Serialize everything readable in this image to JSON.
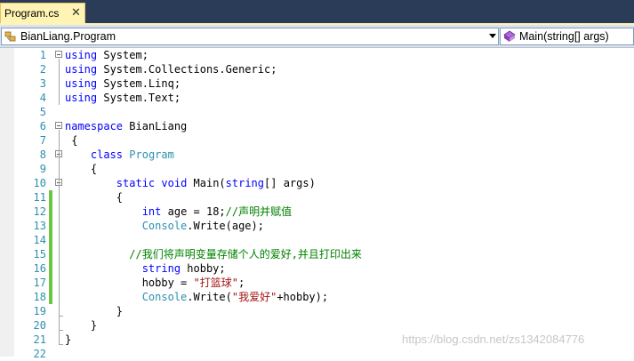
{
  "tab": {
    "title": "Program.cs",
    "close_glyph": "✕"
  },
  "navbar": {
    "type_combo": "BianLiang.Program",
    "member_combo": "Main(string[] args)"
  },
  "editor": {
    "lines": [
      {
        "n": "1",
        "tokens": [
          [
            "kw",
            "using"
          ],
          [
            "",
            " System;"
          ]
        ]
      },
      {
        "n": "2",
        "tokens": [
          [
            "kw",
            "using"
          ],
          [
            "",
            " System.Collections.Generic;"
          ]
        ]
      },
      {
        "n": "3",
        "tokens": [
          [
            "kw",
            "using"
          ],
          [
            "",
            " System.Linq;"
          ]
        ]
      },
      {
        "n": "4",
        "tokens": [
          [
            "kw",
            "using"
          ],
          [
            "",
            " System.Text;"
          ]
        ]
      },
      {
        "n": "5",
        "tokens": []
      },
      {
        "n": "6",
        "tokens": [
          [
            "kw",
            "namespace"
          ],
          [
            "",
            " BianLiang"
          ]
        ]
      },
      {
        "n": "7",
        "tokens": [
          [
            "",
            " {"
          ]
        ]
      },
      {
        "n": "8",
        "tokens": [
          [
            "",
            "    "
          ],
          [
            "kw",
            "class"
          ],
          [
            "",
            " "
          ],
          [
            "ty",
            "Program"
          ]
        ]
      },
      {
        "n": "9",
        "tokens": [
          [
            "",
            "    {"
          ]
        ]
      },
      {
        "n": "10",
        "tokens": [
          [
            "",
            "        "
          ],
          [
            "kw",
            "static"
          ],
          [
            "",
            " "
          ],
          [
            "kw",
            "void"
          ],
          [
            "",
            " Main("
          ],
          [
            "kw",
            "string"
          ],
          [
            "",
            "[] args)"
          ]
        ]
      },
      {
        "n": "11",
        "tokens": [
          [
            "",
            "        {"
          ]
        ]
      },
      {
        "n": "12",
        "tokens": [
          [
            "",
            "            "
          ],
          [
            "kw",
            "int"
          ],
          [
            "",
            " age = 18;"
          ],
          [
            "cm",
            "//声明并赋值"
          ]
        ]
      },
      {
        "n": "13",
        "tokens": [
          [
            "",
            "            "
          ],
          [
            "ty",
            "Console"
          ],
          [
            "",
            ".Write(age);"
          ]
        ]
      },
      {
        "n": "14",
        "tokens": []
      },
      {
        "n": "15",
        "tokens": [
          [
            "",
            "          "
          ],
          [
            "cm",
            "//我们将声明变量存储个人的爱好,并且打印出来"
          ]
        ]
      },
      {
        "n": "16",
        "tokens": [
          [
            "",
            "            "
          ],
          [
            "kw",
            "string"
          ],
          [
            "",
            " hobby;"
          ]
        ]
      },
      {
        "n": "17",
        "tokens": [
          [
            "",
            "            hobby = "
          ],
          [
            "st",
            "\"打篮球\""
          ],
          [
            "",
            ";"
          ]
        ]
      },
      {
        "n": "18",
        "tokens": [
          [
            "",
            "            "
          ],
          [
            "ty",
            "Console"
          ],
          [
            "",
            ".Write("
          ],
          [
            "st",
            "\"我爱好\""
          ],
          [
            "",
            "+hobby);"
          ]
        ]
      },
      {
        "n": "19",
        "tokens": [
          [
            "",
            "        }"
          ]
        ]
      },
      {
        "n": "20",
        "tokens": [
          [
            "",
            "    }"
          ]
        ]
      },
      {
        "n": "21",
        "tokens": [
          [
            "",
            "}"
          ]
        ]
      },
      {
        "n": "22",
        "tokens": []
      }
    ],
    "changed_lines": [
      "11",
      "12",
      "13",
      "14",
      "15",
      "16",
      "17",
      "18"
    ],
    "colors": {
      "keyword": "#0000ff",
      "type": "#2b91af",
      "comment": "#008000",
      "string": "#a31515",
      "change_bar": "#6cc644"
    }
  },
  "watermark": "https://blog.csdn.net/zs1342084776"
}
